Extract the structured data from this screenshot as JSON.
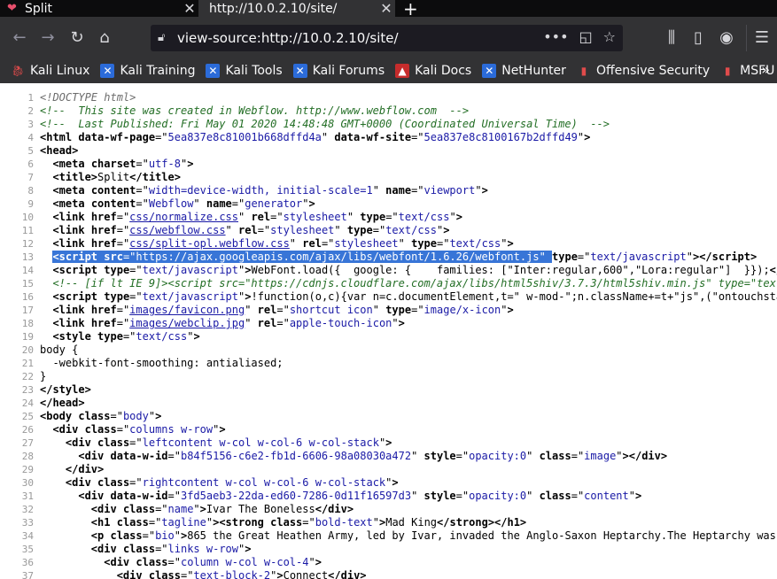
{
  "tabs": [
    {
      "title": "Split",
      "active": false,
      "favicon": "heart-icon",
      "close": "✕"
    },
    {
      "title": "http://10.0.2.10/site/",
      "active": true,
      "close": "✕"
    }
  ],
  "newtab": "+",
  "nav": {
    "url": "view-source:http://10.0.2.10/site/",
    "back": "←",
    "forward": "→",
    "reload": "↻",
    "home": "⌂",
    "more": "•••",
    "pocket": "◱",
    "star": "☆",
    "library": "⫼",
    "sidebar": "▯",
    "account": "◉",
    "menu": "☰"
  },
  "bookmarks": [
    {
      "label": "Kali Linux",
      "icon": "kali-dragon-icon",
      "style": "kali"
    },
    {
      "label": "Kali Training",
      "icon": "kali-training-icon",
      "style": "blue"
    },
    {
      "label": "Kali Tools",
      "icon": "kali-tools-icon",
      "style": "blue"
    },
    {
      "label": "Kali Forums",
      "icon": "kali-forums-icon",
      "style": "blue"
    },
    {
      "label": "Kali Docs",
      "icon": "kali-docs-icon",
      "style": "red"
    },
    {
      "label": "NetHunter",
      "icon": "nethunter-icon",
      "style": "blue"
    },
    {
      "label": "Offensive Security",
      "icon": "offsec-icon",
      "style": "grey"
    },
    {
      "label": "MSFU",
      "icon": "msfu-icon",
      "style": "grey"
    }
  ],
  "bookmarks_more": "»",
  "source_lines": [
    "1",
    "2",
    "3",
    "4",
    "5",
    "6",
    "7",
    "8",
    "9",
    "10",
    "11",
    "12",
    "13",
    "14",
    "15",
    "16",
    "17",
    "18",
    "19",
    "20",
    "21",
    "22",
    "23",
    "24",
    "25",
    "26",
    "27",
    "28",
    "29",
    "30",
    "31",
    "32",
    "33",
    "34",
    "35",
    "36",
    "37"
  ]
}
